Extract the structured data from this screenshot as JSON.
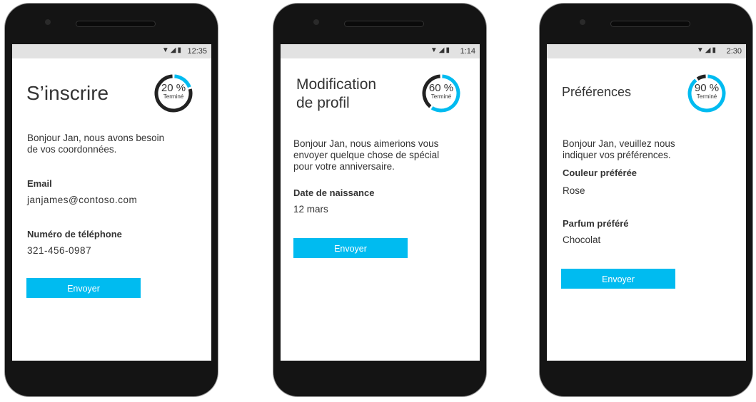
{
  "colors": {
    "accent": "#00bbf0",
    "ring_rest": "#222222"
  },
  "screens": [
    {
      "time": "12:35",
      "title": "S’inscrire",
      "progress": 20,
      "progress_label": "20 %",
      "progress_sub": "Terminé",
      "message": "Bonjour Jan, nous avons besoin de vos coordonnées.",
      "fields": [
        {
          "label": "Email",
          "value": "janjames@contoso.com"
        },
        {
          "label": "Numéro de téléphone",
          "value": "321-456-0987"
        }
      ],
      "button": "Envoyer"
    },
    {
      "time": "1:14",
      "title_line1": "Modification",
      "title_line2": "de profil",
      "progress": 60,
      "progress_label": "60 %",
      "progress_sub": "Terminé",
      "message": "Bonjour Jan, nous aimerions vous envoyer quelque chose de spécial pour votre anniversaire.",
      "fields": [
        {
          "label": "Date de naissance",
          "value": "12 mars"
        }
      ],
      "button": "Envoyer"
    },
    {
      "time": "2:30",
      "title": "Préférences",
      "progress": 90,
      "progress_label": "90 %",
      "progress_sub": "Terminé",
      "message": "Bonjour Jan, veuillez nous indiquer vos préférences.",
      "fields": [
        {
          "label": "Couleur préférée",
          "value": "Rose"
        },
        {
          "label": "Parfum préféré",
          "value": "Chocolat"
        }
      ],
      "button": "Envoyer"
    }
  ]
}
